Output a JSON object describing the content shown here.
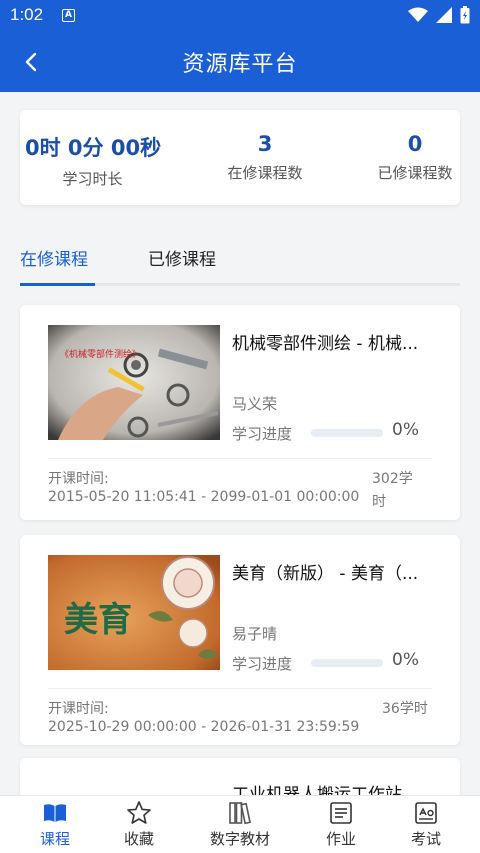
{
  "status": {
    "time": "1:02"
  },
  "header": {
    "title": "资源库平台"
  },
  "stats": [
    {
      "value": "0时 0分 00秒",
      "label": "学习时长"
    },
    {
      "value": "3",
      "label": "在修课程数"
    },
    {
      "value": "0",
      "label": "已修课程数"
    }
  ],
  "tabs": {
    "active": "在修课程",
    "inactive": "已修课程"
  },
  "courses": [
    {
      "title": "机械零部件测绘 - 机械...",
      "teacher": "马义荣",
      "progress_label": "学习进度",
      "progress_value": "0%",
      "progress_fraction": 0,
      "time_label": "开课时间:",
      "time_range": "2015-05-20 11:05:41 - 2099-01-01 00:00:00",
      "hours_line1": "302学",
      "hours_line2": "时",
      "thumb_text": "《机械零部件测绘》"
    },
    {
      "title": "美育（新版） - 美育（...",
      "teacher": "易子晴",
      "progress_label": "学习进度",
      "progress_value": "0%",
      "progress_fraction": 0,
      "time_label": "开课时间:",
      "time_range": "2025-10-29 00:00:00 - 2026-01-31 23:59:59",
      "hours": "36学时",
      "thumb_text": "美育"
    },
    {
      "title": "工业机器人搬运工作站"
    }
  ],
  "nav": [
    {
      "label": "课程",
      "icon": "book-icon"
    },
    {
      "label": "收藏",
      "icon": "star-icon"
    },
    {
      "label": "数字教材",
      "icon": "books-icon"
    },
    {
      "label": "作业",
      "icon": "homework-icon"
    },
    {
      "label": "考试",
      "icon": "exam-icon"
    }
  ],
  "colors": {
    "primary": "#1a5fd6",
    "stat_value": "#1a4fa8"
  }
}
